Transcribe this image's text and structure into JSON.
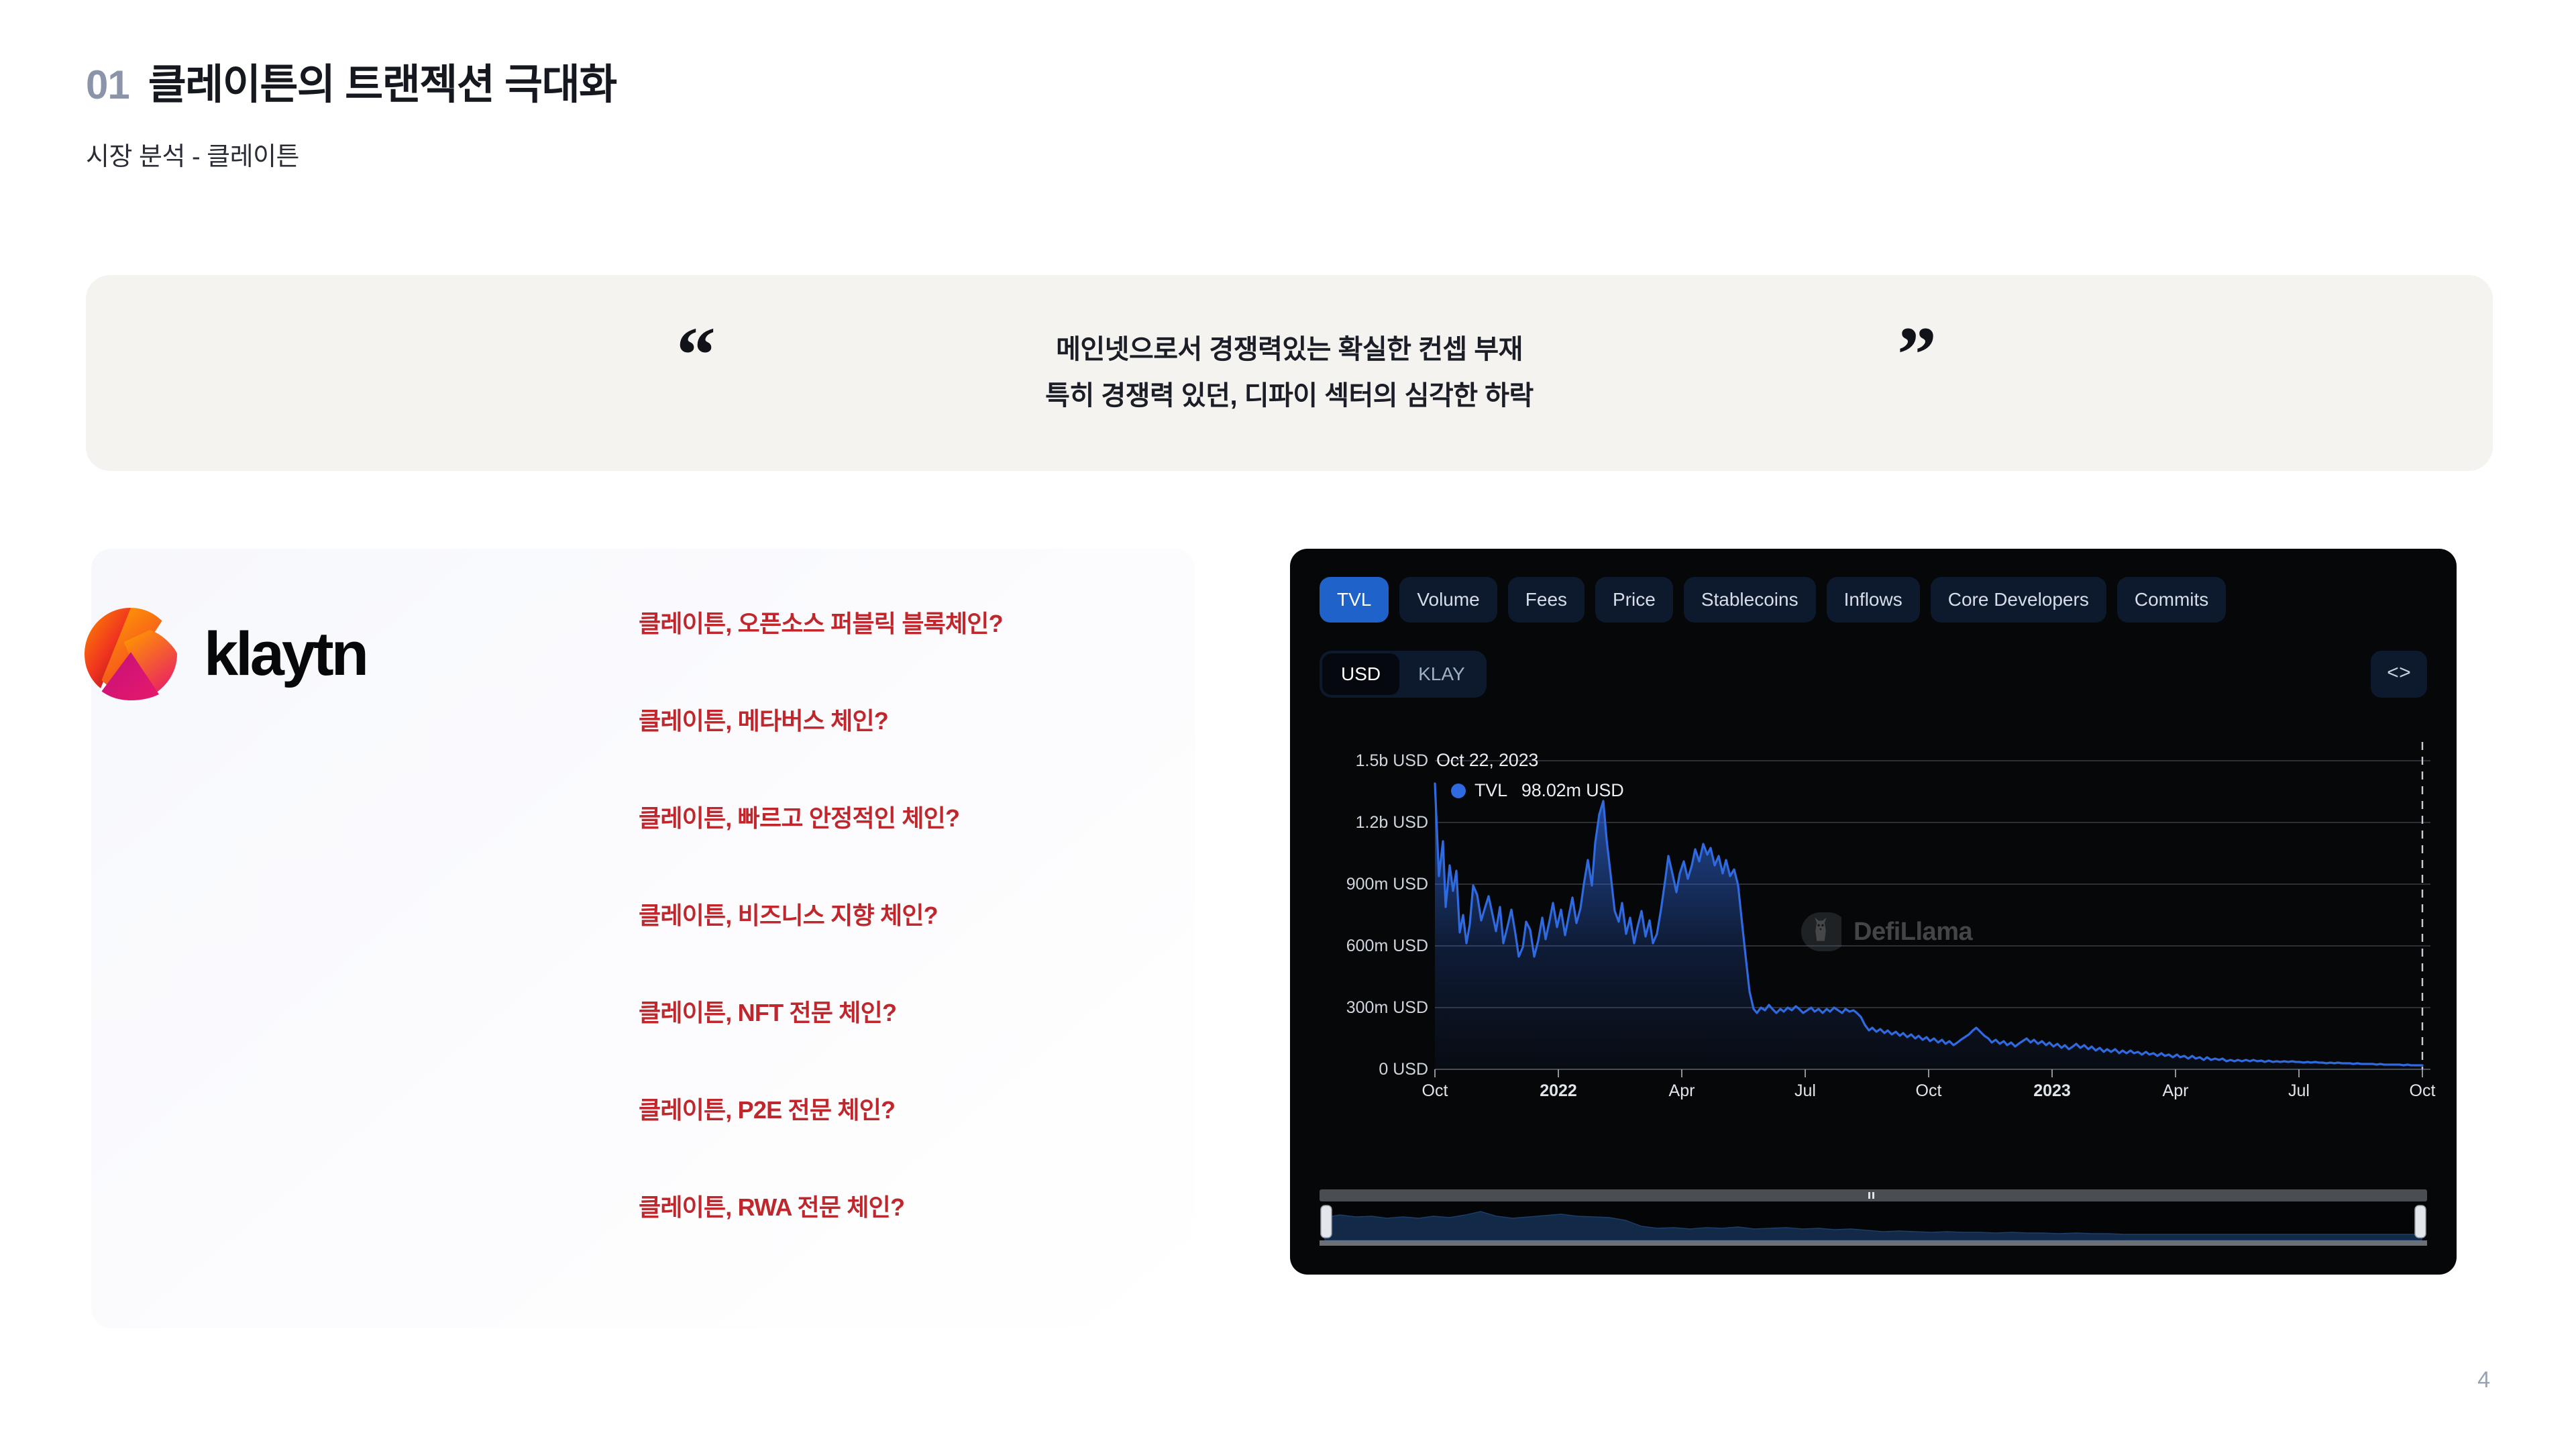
{
  "header": {
    "section_number": "01",
    "title": "클레이튼의 트랜젝션 극대화",
    "subtitle": "시장 분석 - 클레이튼"
  },
  "quote": {
    "open_mark": "“",
    "close_mark": "”",
    "line1": "메인넷으로서 경쟁력있는 확실한 컨셉 부재",
    "line2": "특히 경쟁력 있던, 디파이 섹터의 심각한 하락"
  },
  "left_card": {
    "logo_name": "klaytn-logo",
    "wordmark": "klaytn",
    "questions": [
      "클레이튼, 오픈소스 퍼블릭 블록체인?",
      "클레이튼, 메타버스 체인?",
      "클레이튼, 빠르고 안정적인 체인?",
      "클레이튼, 비즈니스 지향 체인?",
      "클레이튼, NFT 전문 체인?",
      "클레이튼, P2E 전문 체인?",
      "클레이튼, RWA 전문 체인?"
    ],
    "accent_color": "#c0272d"
  },
  "chart_panel": {
    "tabs": [
      {
        "label": "TVL",
        "active": true
      },
      {
        "label": "Volume",
        "active": false
      },
      {
        "label": "Fees",
        "active": false
      },
      {
        "label": "Price",
        "active": false
      },
      {
        "label": "Stablecoins",
        "active": false
      },
      {
        "label": "Inflows",
        "active": false
      },
      {
        "label": "Core Developers",
        "active": false
      },
      {
        "label": "Commits",
        "active": false
      }
    ],
    "unit_toggle": [
      {
        "label": "USD",
        "active": true
      },
      {
        "label": "KLAY",
        "active": false
      }
    ],
    "embed_icon_label": "<>",
    "tooltip": {
      "date": "Oct 22, 2023",
      "series": "TVL",
      "value": "98.02m USD"
    },
    "watermark": "DefiLlama",
    "active_color": "#1f62c9",
    "line_color": "#2f6ae0"
  },
  "chart_data": {
    "type": "area",
    "title": "Klaytn TVL",
    "xlabel": "",
    "ylabel": "USD",
    "ylim": [
      0,
      1500000000
    ],
    "ytick_labels": [
      "0 USD",
      "300m USD",
      "600m USD",
      "900m USD",
      "1.2b USD",
      "1.5b USD"
    ],
    "ytick_values": [
      0,
      300000000,
      600000000,
      900000000,
      1200000000,
      1500000000
    ],
    "xtick_labels": [
      "Oct",
      "2022",
      "Apr",
      "Jul",
      "Oct",
      "2023",
      "Apr",
      "Jul",
      "Oct"
    ],
    "xtick_positions": [
      0.03,
      0.155,
      0.28,
      0.4,
      0.525,
      0.645,
      0.77,
      0.885,
      0.99
    ],
    "grid": true,
    "legend": [
      "TVL"
    ],
    "legend_position": "tooltip",
    "annotations": [
      "Oct 22, 2023 — TVL 98.02m USD"
    ],
    "series": [
      {
        "name": "TVL",
        "units": "USD",
        "x": [
          "2021-10",
          "2021-10b",
          "2021-11",
          "2021-11b",
          "2021-12",
          "2021-12b",
          "2022-01",
          "2022-01b",
          "2022-02",
          "2022-02b",
          "2022-03",
          "2022-03b",
          "2022-04",
          "2022-04b",
          "2022-05",
          "2022-05b",
          "2022-06",
          "2022-06b",
          "2022-07",
          "2022-07b",
          "2022-08",
          "2022-08b",
          "2022-09",
          "2022-09b",
          "2022-10",
          "2022-10b",
          "2022-11",
          "2022-11b",
          "2022-12",
          "2022-12b",
          "2023-01",
          "2023-01b",
          "2023-02",
          "2023-02b",
          "2023-03",
          "2023-03b",
          "2023-04",
          "2023-04b",
          "2023-05",
          "2023-05b",
          "2023-06",
          "2023-06b",
          "2023-07",
          "2023-07b",
          "2023-08",
          "2023-08b",
          "2023-09",
          "2023-09b",
          "2023-10",
          "2023-10-22"
        ],
        "values": [
          1400000000,
          1080000000,
          900000000,
          1060000000,
          980000000,
          935000000,
          1000000000,
          905000000,
          955000000,
          990000000,
          1080000000,
          1180000000,
          1290000000,
          960000000,
          935000000,
          900000000,
          960000000,
          1000000000,
          1160000000,
          1120000000,
          1135000000,
          1180000000,
          1140000000,
          1050000000,
          880000000,
          360000000,
          330000000,
          350000000,
          345000000,
          330000000,
          350000000,
          355000000,
          250000000,
          235000000,
          215000000,
          205000000,
          225000000,
          215000000,
          250000000,
          230000000,
          225000000,
          230000000,
          235000000,
          205000000,
          195000000,
          185000000,
          180000000,
          160000000,
          130000000,
          98020000
        ]
      }
    ]
  },
  "page_number": "4"
}
